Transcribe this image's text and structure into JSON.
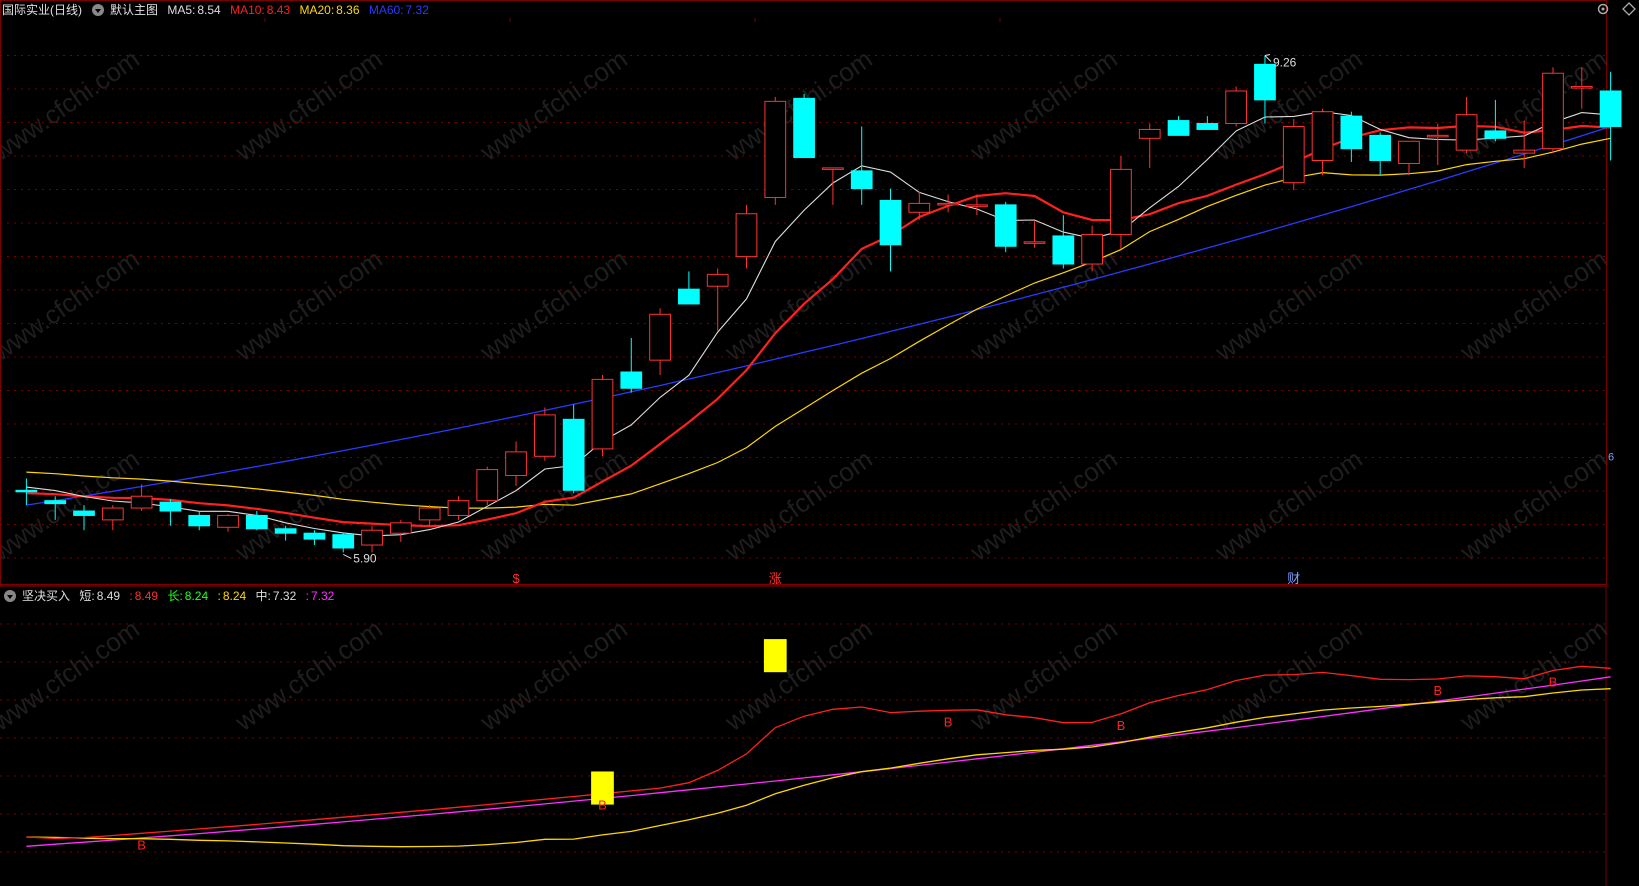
{
  "main_chart": {
    "stock_name": "国际实业(日线)",
    "main_label": "默认主图",
    "ma_readouts": [
      {
        "label": "MA5:",
        "value": "8.54",
        "color": "#dddddd"
      },
      {
        "label": "MA10:",
        "value": "8.43",
        "color": "#ff2020"
      },
      {
        "label": "MA20:",
        "value": "8.36",
        "color": "#ffd700"
      },
      {
        "label": "MA60:",
        "value": "7.32",
        "color": "#2a3aff"
      }
    ],
    "high_label": "9.26",
    "low_label": "5.90",
    "event_markers": [
      {
        "text": "$",
        "index": 17
      },
      {
        "text": "涨",
        "index": 26
      },
      {
        "text": "财",
        "index": 44
      }
    ],
    "right_edge_label": "6",
    "price_range": [
      5.7,
      9.5
    ]
  },
  "indicator": {
    "name": "坚决买入",
    "readouts": [
      {
        "label": "短:",
        "value": "8.49",
        "color": "#dddddd"
      },
      {
        "label": ":",
        "value": "8.49",
        "color": "#ff3030"
      },
      {
        "label": "长:",
        "value": "8.24",
        "color": "#20ff20"
      },
      {
        "label": ":",
        "value": "8.24",
        "color": "#ffd700"
      },
      {
        "label": "中:",
        "value": "7.32",
        "color": "#dddddd"
      },
      {
        "label": ":",
        "value": "7.32",
        "color": "#ff30ff"
      }
    ],
    "buy_label": "B",
    "value_range": [
      5.6,
      9.8
    ],
    "buy_markers": [
      4,
      20,
      32,
      38,
      49,
      53
    ],
    "signal_bars": [
      {
        "index": 20,
        "top": 7.3,
        "bottom": 6.8
      },
      {
        "index": 26,
        "top": 9.3,
        "bottom": 8.8
      }
    ]
  },
  "watermark_text": "www.cfchi.com",
  "colors": {
    "up": "#ff3232",
    "down": "#00ffff",
    "ma5": "#dddddd",
    "ma10": "#ff2020",
    "ma20": "#ffd700",
    "ma60": "#2a3aff",
    "grid": "#7a0000",
    "signal": "#ffff00"
  },
  "chart_data": {
    "type": "candlestick",
    "series_names": [
      "MA5",
      "MA10",
      "MA20",
      "MA60"
    ],
    "candles": [
      {
        "o": 6.32,
        "h": 6.4,
        "l": 6.22,
        "c": 6.31
      },
      {
        "o": 6.25,
        "h": 6.28,
        "l": 6.12,
        "c": 6.23
      },
      {
        "o": 6.18,
        "h": 6.22,
        "l": 6.05,
        "c": 6.15
      },
      {
        "o": 6.12,
        "h": 6.22,
        "l": 6.05,
        "c": 6.2
      },
      {
        "o": 6.2,
        "h": 6.36,
        "l": 6.18,
        "c": 6.28
      },
      {
        "o": 6.24,
        "h": 6.26,
        "l": 6.08,
        "c": 6.18
      },
      {
        "o": 6.15,
        "h": 6.18,
        "l": 6.05,
        "c": 6.08
      },
      {
        "o": 6.07,
        "h": 6.16,
        "l": 6.04,
        "c": 6.15
      },
      {
        "o": 6.15,
        "h": 6.18,
        "l": 6.05,
        "c": 6.06
      },
      {
        "o": 6.06,
        "h": 6.08,
        "l": 5.98,
        "c": 6.03
      },
      {
        "o": 6.03,
        "h": 6.05,
        "l": 5.95,
        "c": 5.99
      },
      {
        "o": 6.02,
        "h": 6.03,
        "l": 5.9,
        "c": 5.93
      },
      {
        "o": 5.95,
        "h": 6.08,
        "l": 5.9,
        "c": 6.05
      },
      {
        "o": 6.03,
        "h": 6.12,
        "l": 5.97,
        "c": 6.1
      },
      {
        "o": 6.12,
        "h": 6.22,
        "l": 6.08,
        "c": 6.2
      },
      {
        "o": 6.15,
        "h": 6.28,
        "l": 6.12,
        "c": 6.25
      },
      {
        "o": 6.25,
        "h": 6.48,
        "l": 6.22,
        "c": 6.46
      },
      {
        "o": 6.42,
        "h": 6.65,
        "l": 6.35,
        "c": 6.58
      },
      {
        "o": 6.55,
        "h": 6.88,
        "l": 6.52,
        "c": 6.83
      },
      {
        "o": 6.8,
        "h": 6.9,
        "l": 6.3,
        "c": 6.32
      },
      {
        "o": 6.6,
        "h": 7.1,
        "l": 6.55,
        "c": 7.07
      },
      {
        "o": 7.12,
        "h": 7.35,
        "l": 6.98,
        "c": 7.01
      },
      {
        "o": 7.2,
        "h": 7.55,
        "l": 7.1,
        "c": 7.51
      },
      {
        "o": 7.68,
        "h": 7.8,
        "l": 7.65,
        "c": 7.58
      },
      {
        "o": 7.7,
        "h": 7.82,
        "l": 7.4,
        "c": 7.78
      },
      {
        "o": 7.9,
        "h": 8.25,
        "l": 7.82,
        "c": 8.19
      },
      {
        "o": 8.3,
        "h": 8.98,
        "l": 8.25,
        "c": 8.95
      },
      {
        "o": 8.97,
        "h": 9.0,
        "l": 8.6,
        "c": 8.57
      },
      {
        "o": 8.5,
        "h": 8.5,
        "l": 8.25,
        "c": 8.5
      },
      {
        "o": 8.48,
        "h": 8.78,
        "l": 8.25,
        "c": 8.36
      },
      {
        "o": 8.28,
        "h": 8.36,
        "l": 7.8,
        "c": 7.98
      },
      {
        "o": 8.2,
        "h": 8.34,
        "l": 8.15,
        "c": 8.26
      },
      {
        "o": 8.26,
        "h": 8.32,
        "l": 8.2,
        "c": 8.26
      },
      {
        "o": 8.25,
        "h": 8.32,
        "l": 8.18,
        "c": 8.25
      },
      {
        "o": 8.25,
        "h": 8.27,
        "l": 7.93,
        "c": 7.97
      },
      {
        "o": 8.0,
        "h": 8.14,
        "l": 7.96,
        "c": 8.0
      },
      {
        "o": 8.04,
        "h": 8.18,
        "l": 7.82,
        "c": 7.85
      },
      {
        "o": 7.85,
        "h": 8.11,
        "l": 7.8,
        "c": 8.05
      },
      {
        "o": 8.05,
        "h": 8.58,
        "l": 7.95,
        "c": 8.49
      },
      {
        "o": 8.7,
        "h": 8.8,
        "l": 8.5,
        "c": 8.76
      },
      {
        "o": 8.82,
        "h": 8.85,
        "l": 8.72,
        "c": 8.72
      },
      {
        "o": 8.8,
        "h": 8.85,
        "l": 8.76,
        "c": 8.76
      },
      {
        "o": 8.8,
        "h": 9.05,
        "l": 8.78,
        "c": 9.02
      },
      {
        "o": 9.2,
        "h": 9.26,
        "l": 8.8,
        "c": 8.96
      },
      {
        "o": 8.4,
        "h": 8.83,
        "l": 8.35,
        "c": 8.78
      },
      {
        "o": 8.55,
        "h": 8.9,
        "l": 8.45,
        "c": 8.88
      },
      {
        "o": 8.85,
        "h": 8.88,
        "l": 8.54,
        "c": 8.63
      },
      {
        "o": 8.72,
        "h": 8.74,
        "l": 8.45,
        "c": 8.55
      },
      {
        "o": 8.53,
        "h": 8.68,
        "l": 8.45,
        "c": 8.68
      },
      {
        "o": 8.71,
        "h": 8.8,
        "l": 8.52,
        "c": 8.72
      },
      {
        "o": 8.62,
        "h": 8.98,
        "l": 8.6,
        "c": 8.86
      },
      {
        "o": 8.75,
        "h": 8.96,
        "l": 8.68,
        "c": 8.7
      },
      {
        "o": 8.6,
        "h": 8.82,
        "l": 8.5,
        "c": 8.62
      },
      {
        "o": 8.63,
        "h": 9.18,
        "l": 8.6,
        "c": 9.14
      },
      {
        "o": 9.05,
        "h": 9.18,
        "l": 8.9,
        "c": 9.05
      },
      {
        "o": 9.02,
        "h": 9.15,
        "l": 8.55,
        "c": 8.78
      }
    ]
  }
}
